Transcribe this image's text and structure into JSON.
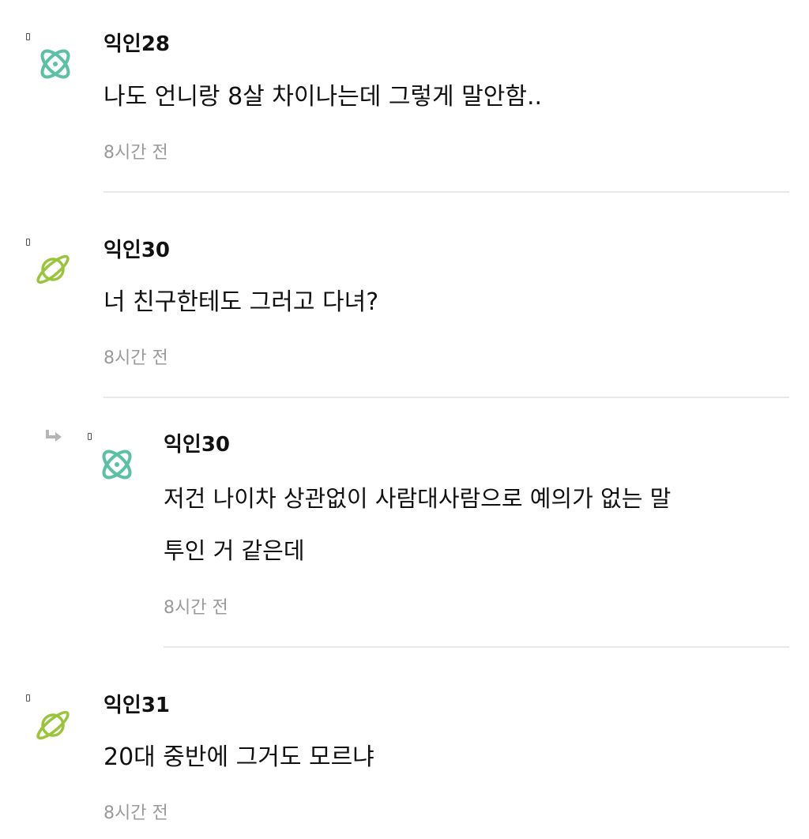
{
  "colors": {
    "text": "#111111",
    "time": "#9a9a9a",
    "divider": "#e8e8e8",
    "avatar_teal": "#5cc0a4",
    "avatar_lime": "#9ac43c",
    "reply_arrow": "#b5b5b5"
  },
  "comments": [
    {
      "author": "익인28",
      "avatar_icon": "atom-icon",
      "lines": [
        "나도 언니랑 8살 차이나는데 그렇게 말안함.."
      ],
      "time": "8시간 전"
    },
    {
      "author": "익인30",
      "avatar_icon": "planet-icon",
      "lines": [
        "너 친구한테도 그러고 다녀?"
      ],
      "time": "8시간 전"
    },
    {
      "author": "익인30",
      "avatar_icon": "atom-icon",
      "is_reply": true,
      "lines": [
        "저건 나이차 상관없이 사람대사람으로 예의가 없는 말",
        "투인 거 같은데"
      ],
      "time": "8시간 전"
    },
    {
      "author": "익인31",
      "avatar_icon": "planet-icon",
      "lines": [
        "20대 중반에 그거도 모르냐"
      ],
      "time": "8시간 전"
    }
  ]
}
